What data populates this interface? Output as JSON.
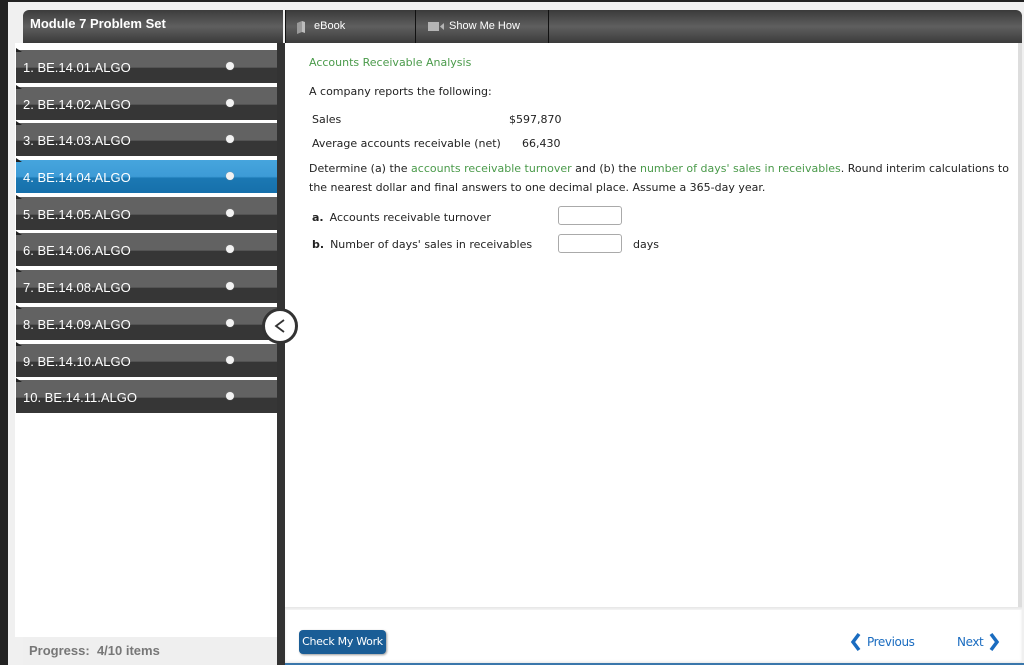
{
  "sidebar": {
    "title": "Module 7 Problem Set",
    "items": [
      {
        "label": "1. BE.14.01.ALGO",
        "active": false
      },
      {
        "label": "2. BE.14.02.ALGO",
        "active": false
      },
      {
        "label": "3. BE.14.03.ALGO",
        "active": false
      },
      {
        "label": "4. BE.14.04.ALGO",
        "active": true
      },
      {
        "label": "5. BE.14.05.ALGO",
        "active": false
      },
      {
        "label": "6. BE.14.06.ALGO",
        "active": false
      },
      {
        "label": "7. BE.14.08.ALGO",
        "active": false
      },
      {
        "label": "8. BE.14.09.ALGO",
        "active": false
      },
      {
        "label": "9. BE.14.10.ALGO",
        "active": false
      },
      {
        "label": "10. BE.14.11.ALGO",
        "active": false
      }
    ],
    "progress_label": "Progress:",
    "progress_value": "4/10 items",
    "progress": {
      "completed": 4,
      "total": 10
    }
  },
  "toolbar": {
    "ebook_label": "eBook",
    "show_me_how_label": "Show Me How"
  },
  "problem": {
    "title": "Accounts Receivable Analysis",
    "intro": "A company reports the following:",
    "data": [
      {
        "label": "Sales",
        "value": "$597,870"
      },
      {
        "label": "Average accounts receivable (net)",
        "value": "66,430"
      }
    ],
    "instructions": {
      "part1": "Determine (a) the ",
      "link1": "accounts receivable turnover",
      "part2": " and (b) the ",
      "link2": "number of days' sales in receivables",
      "part3": ". Round interim calculations to the nearest dollar and final answers to one decimal place. Assume a 365-day year."
    },
    "answers": [
      {
        "letter": "a.",
        "label": "Accounts receivable turnover",
        "value": "",
        "unit": ""
      },
      {
        "letter": "b.",
        "label": "Number of days' sales in receivables",
        "value": "",
        "unit": "days"
      }
    ]
  },
  "footer": {
    "check_label": "Check My Work",
    "previous_label": "Previous",
    "next_label": "Next"
  },
  "colors": {
    "accent_green": "#4a9a4a",
    "active_blue": "#3d9bd6",
    "button_blue": "#1a5d96",
    "nav_blue": "#1a6cc0"
  }
}
